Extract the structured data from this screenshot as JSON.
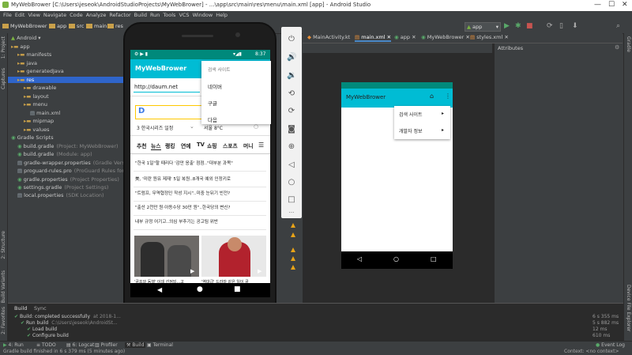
{
  "window": {
    "title": "MyWebBrower [C:\\Users\\jeseok\\AndroidStudioProjects\\MyWebBrower] - ...\\app\\src\\main\\res\\menu\\main.xml [app] - Android Studio"
  },
  "menubar": [
    "File",
    "Edit",
    "View",
    "Navigate",
    "Code",
    "Analyze",
    "Refactor",
    "Build",
    "Run",
    "Tools",
    "VCS",
    "Window",
    "Help"
  ],
  "breadcrumbs": [
    "MyWebBrower",
    "app",
    "src",
    "main",
    "res"
  ],
  "run_config": "app",
  "left_tabs": [
    "1: Project",
    "Captures",
    "2: Structure",
    "Build Variants",
    "2: Favorites"
  ],
  "project": {
    "view": "Android",
    "tree": [
      {
        "label": "app",
        "hint": ""
      },
      {
        "label": "manifests",
        "hint": ""
      },
      {
        "label": "java",
        "hint": ""
      },
      {
        "label": "generatedJava",
        "hint": ""
      },
      {
        "label": "res",
        "hint": ""
      },
      {
        "label": "drawable",
        "hint": ""
      },
      {
        "label": "layout",
        "hint": ""
      },
      {
        "label": "menu",
        "hint": ""
      },
      {
        "label": "main.xml",
        "hint": ""
      },
      {
        "label": "mipmap",
        "hint": ""
      },
      {
        "label": "values",
        "hint": ""
      },
      {
        "label": "Gradle Scripts",
        "hint": ""
      },
      {
        "label": "build.gradle",
        "hint": "(Project: MyWebBrower)"
      },
      {
        "label": "build.gradle",
        "hint": "(Module: app)"
      },
      {
        "label": "gradle-wrapper.properties",
        "hint": "(Gradle Version)"
      },
      {
        "label": "proguard-rules.pro",
        "hint": "(ProGuard Rules for app)"
      },
      {
        "label": "gradle.properties",
        "hint": "(Project Properties)"
      },
      {
        "label": "settings.gradle",
        "hint": "(Project Settings)"
      },
      {
        "label": "local.properties",
        "hint": "(SDK Location)"
      }
    ]
  },
  "editor_tabs": [
    "MainActivity.kt",
    "main.xml",
    "app",
    "MyWebBrower",
    "styles.xml"
  ],
  "attributes_label": "Attributes",
  "right_tabs": [
    "Gradle",
    "Device File Explorer"
  ],
  "phone": {
    "time": "8:37",
    "app_title": "MyWebBrower",
    "url": "http://daum.net",
    "menu_header": "검색 사이트",
    "menu_items": [
      "네이버",
      "구글",
      "다음"
    ],
    "trend": "3  한국시리즈 일정",
    "weather": "서울  8°C",
    "nav_tabs": [
      "추천",
      "뉴스",
      "랭킹",
      "연예",
      "TV",
      "쇼핑",
      "스포츠",
      "머니"
    ],
    "news": [
      "\"한국 1일\"할 때리다 '감만 응출' 점점..\"대부분 과목\"",
      "美, '미란 원유 제재' 5일 복원..8개국 예외 인정키로",
      "\"트럼프, 무역협정인 작성 지시\"..미중 눈뒤기 빈전?",
      "\"출산 2천만 원·아동수당 30만 원\"..한국당의 변신?",
      "내부 규정 어기고..의심 부추기는 공고팀 위반"
    ],
    "photo_captions": [
      "'골프와 동행' 이데 선정되...고",
      "'역대급' 드라마 같은 일이 골"
    ]
  },
  "preview": {
    "app_title": "MyWebBrower",
    "menu_items": [
      "검색 사이트",
      "개발자 정보"
    ]
  },
  "build": {
    "tabs": [
      "Build",
      "Sync"
    ],
    "lines": [
      {
        "text": "Build: completed successfully",
        "hint": "at 2018-1..."
      },
      {
        "text": "Run build",
        "hint": "C:\\Users\\jeseok\\AndroidSt..."
      },
      {
        "text": "Load build",
        "hint": ""
      },
      {
        "text": "Configure build",
        "hint": ""
      }
    ],
    "times": [
      "6 s 355 ms",
      "5 s 882 ms",
      "12 ms",
      "610 ms"
    ]
  },
  "bottom_tabs": [
    "4: Run",
    "TODO",
    "6: Logcat",
    "Profiler",
    "Build",
    "Terminal"
  ],
  "event_log": "Event Log",
  "status": {
    "message": "Gradle build finished in 6 s 379 ms (5 minutes ago)",
    "context": "Context: <no context>"
  },
  "colors": {
    "teal": "#00bcd4",
    "teal_dark": "#00897b",
    "selection": "#2f65ca"
  }
}
